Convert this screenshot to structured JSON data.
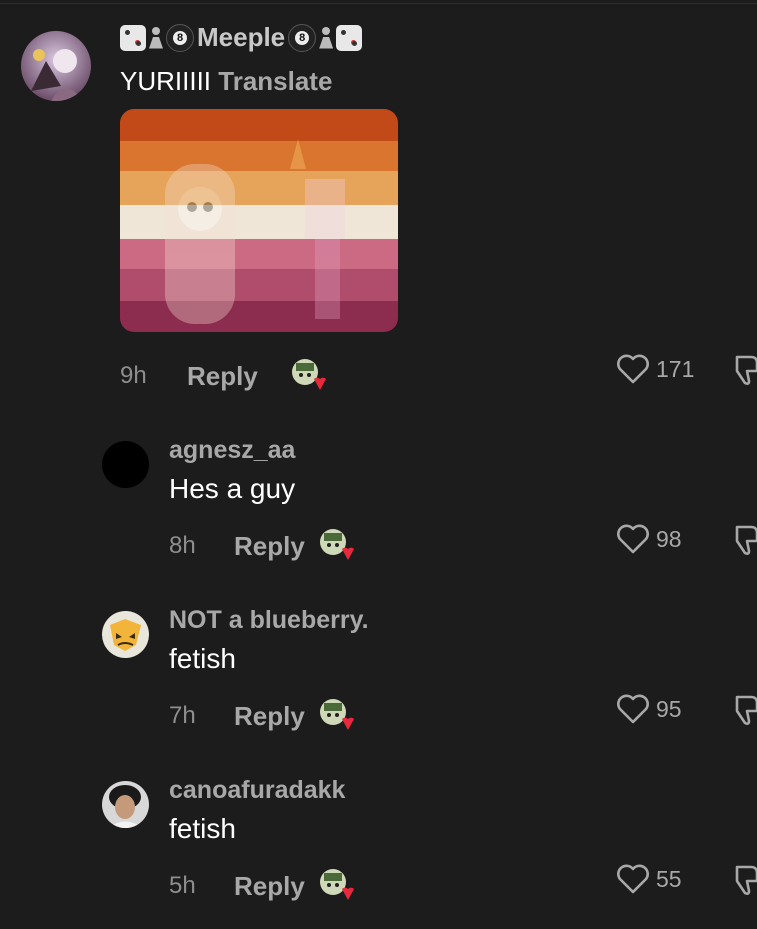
{
  "comments": [
    {
      "username": "Meeple",
      "text": "YURIIIII",
      "translate": "Translate",
      "time": "9h",
      "reply": "Reply",
      "likes": "171"
    },
    {
      "username": "agnesz_aa",
      "text": "Hes a guy",
      "time": "8h",
      "reply": "Reply",
      "likes": "98"
    },
    {
      "username": "NOT a blueberry.",
      "text": "fetish",
      "time": "7h",
      "reply": "Reply",
      "likes": "95"
    },
    {
      "username": "canoafuradakk",
      "text": "fetish",
      "time": "5h",
      "reply": "Reply",
      "likes": "55"
    }
  ],
  "emoji": {
    "eight": "8"
  },
  "colors": {
    "background": "#1c1c1c",
    "username": "#a8a8a8",
    "text": "#ffffff",
    "muted": "#8e8e8e"
  },
  "icons": [
    "dice-emoji",
    "pawn-emoji",
    "8ball-emoji",
    "heart-icon",
    "dislike-icon",
    "sticker-icon"
  ]
}
